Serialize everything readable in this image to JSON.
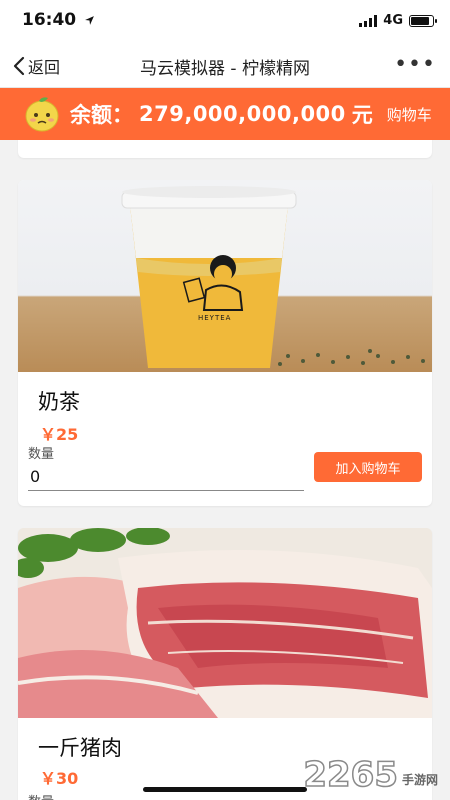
{
  "status_bar": {
    "time": "16:40",
    "network": "4G",
    "icons": [
      "location-arrow-icon",
      "signal-icon",
      "battery-icon"
    ]
  },
  "nav": {
    "back_label": "返回",
    "title": "马云模拟器 - 柠檬精网",
    "more_label": "•••"
  },
  "balance": {
    "label": "余额：",
    "value": "279,000,000,000",
    "unit": "元",
    "cart_label": "购物车",
    "icon": "lemon-face-icon"
  },
  "colors": {
    "accent": "#ff6a35",
    "background": "#f2f2f2"
  },
  "products": [
    {
      "name": "奶茶",
      "price": "￥25",
      "qty_label": "数量",
      "qty_value": "0",
      "add_label": "加入购物车",
      "image": "milk-tea-image",
      "cup_brand": "HEYTEA"
    },
    {
      "name": "一斤猪肉",
      "price": "￥30",
      "qty_label": "数量",
      "image": "pork-image"
    }
  ],
  "watermark": {
    "number": "2265",
    "text": "手游网"
  }
}
